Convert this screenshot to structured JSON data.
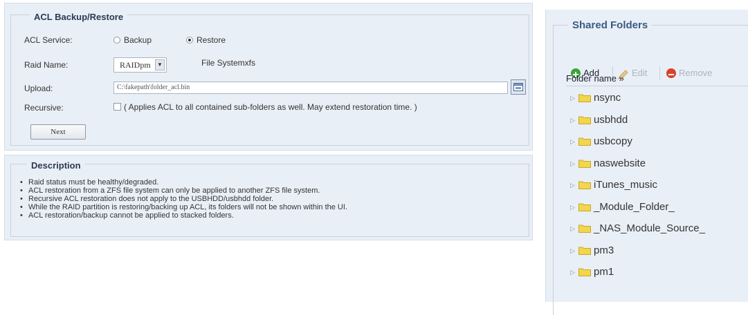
{
  "acl": {
    "legend": "ACL Backup/Restore",
    "service": {
      "label": "ACL Service:",
      "options": [
        {
          "label": "Backup",
          "checked": false
        },
        {
          "label": "Restore",
          "checked": true
        }
      ]
    },
    "raid": {
      "label": "Raid Name:",
      "selected": "RAIDpm",
      "filesystem_text": "File Systemxfs"
    },
    "upload": {
      "label": "Upload:",
      "value": "C:\\fakepath\\folder_acl.bin"
    },
    "recursive": {
      "label": "Recursive:",
      "checked": false,
      "text": "( Applies ACL to all contained sub-folders as well. May extend restoration time. )"
    },
    "next_label": "Next"
  },
  "description": {
    "legend": "Description",
    "items": [
      "Raid status must be healthy/degraded.",
      "ACL restoration from a ZFS file system can only be applied to another ZFS file system.",
      "Recursive ACL restoration does not apply to the USBHDD/usbhdd folder.",
      "While the RAID partition is restoring/backing up ACL, its folders will not be shown within the UI.",
      "ACL restoration/backup cannot be applied to stacked folders."
    ]
  },
  "shared_folders": {
    "legend": "Shared Folders",
    "toolbar": {
      "add_label": "Add",
      "edit_label": "Edit",
      "remove_label": "Remove"
    },
    "column_header": "Folder name »",
    "folders": [
      "nsync",
      "usbhdd",
      "usbcopy",
      "naswebsite",
      "iTunes_music",
      "_Module_Folder_",
      "_NAS_Module_Source_",
      "pm3",
      "pm1"
    ]
  },
  "colors": {
    "panel_bg": "#e9eff6",
    "legend_blue": "#3a5a86",
    "add_green": "#3aa23a",
    "remove_red": "#d9412b",
    "folder_yellow": "#f2d64b"
  },
  "icons": {
    "browse": "browse-icon",
    "add": "add-icon",
    "edit": "edit-icon",
    "remove": "remove-icon",
    "folder": "folder-icon",
    "expander": "expand-arrow-icon"
  }
}
